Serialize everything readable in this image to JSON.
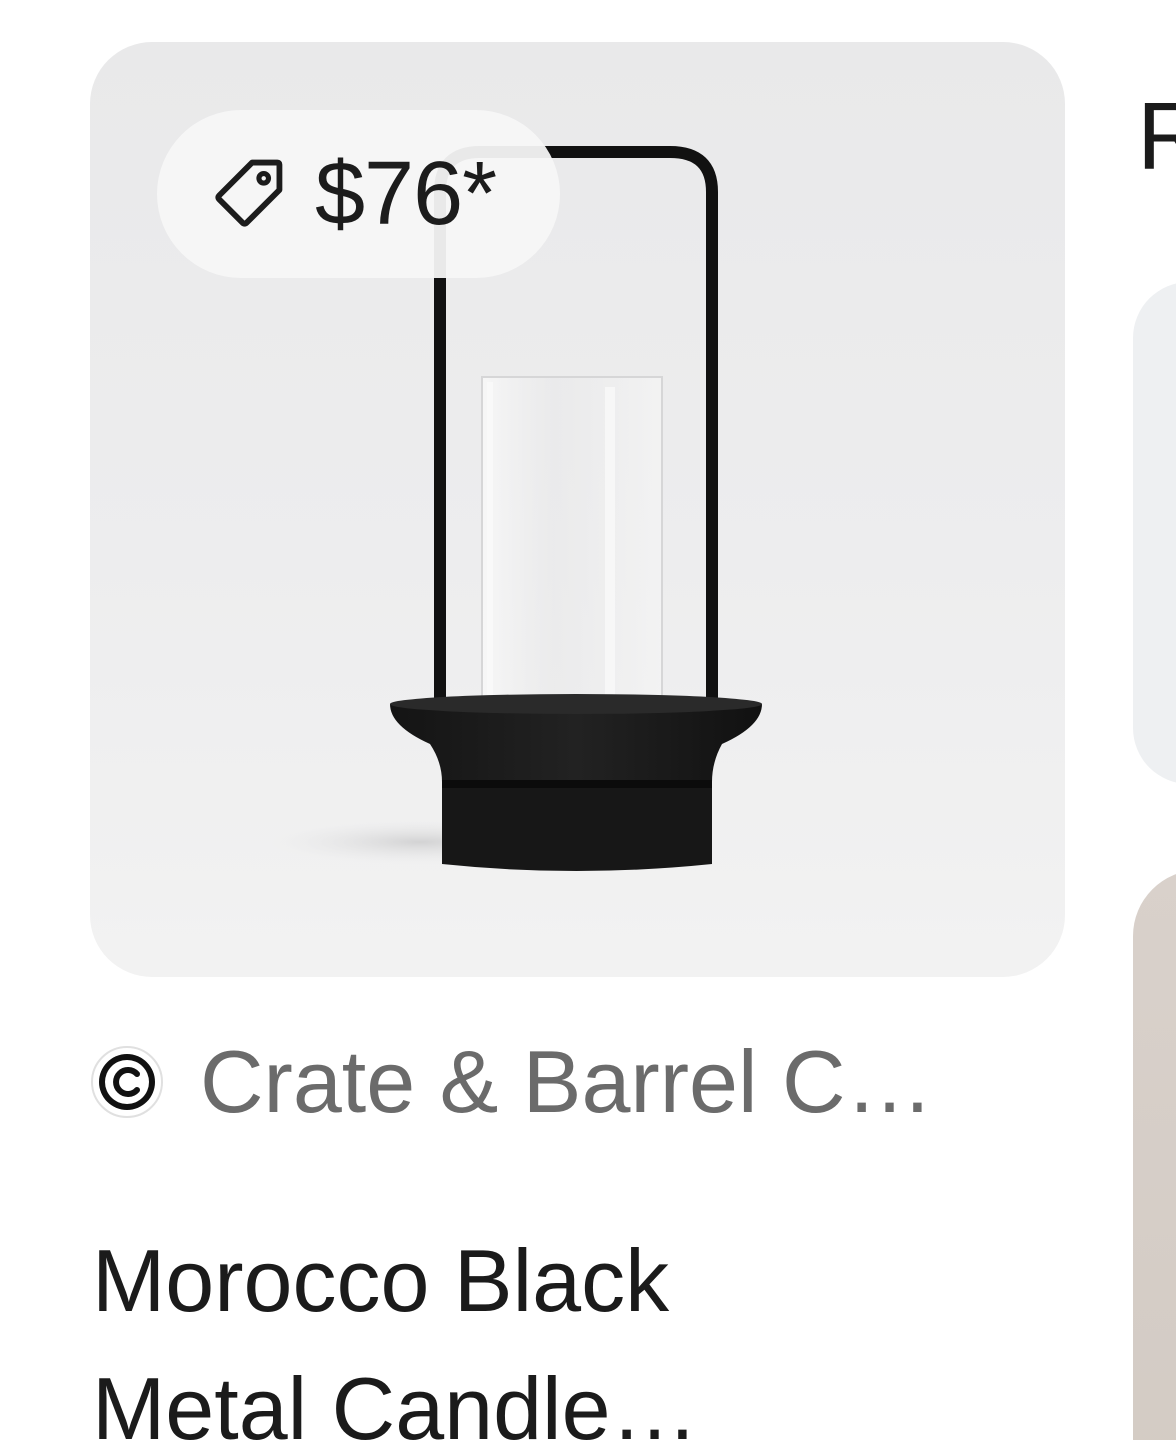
{
  "product": {
    "price": "$76*",
    "source": "Crate & Barrel C…",
    "title_line1": "Morocco Black",
    "title_line2": "Metal Candle…"
  },
  "icons": {
    "price_tag": "tag-icon",
    "source_logo": "crate-and-barrel-logo"
  },
  "next_card": {
    "heading_fragment": "R"
  },
  "colors": {
    "price_text": "#1c1c1c",
    "source_text": "#6b6b6b",
    "title_text": "#1b1b1b",
    "image_background": "#ececed",
    "chip_background": "#f6f6f7"
  }
}
